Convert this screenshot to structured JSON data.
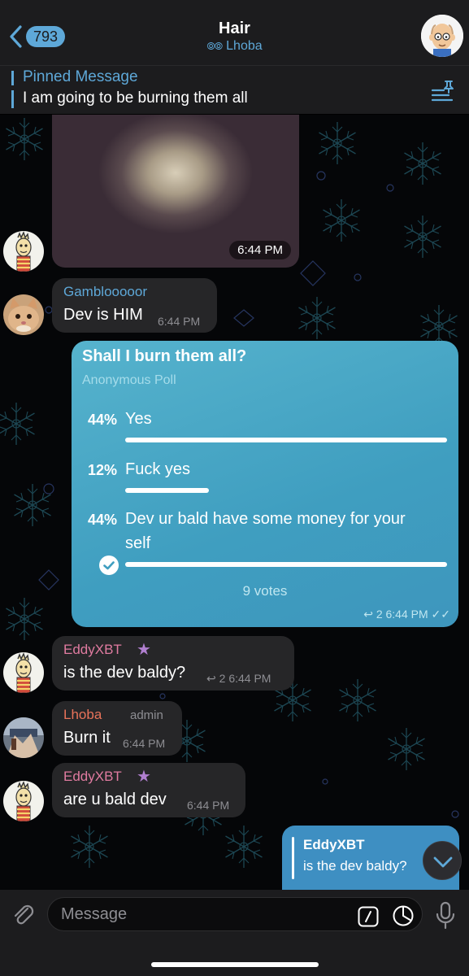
{
  "header": {
    "back_count": "793",
    "title": "Hair",
    "subtitle": "Lhoba",
    "subtitle_icon": "eyes-icon"
  },
  "pinned": {
    "title": "Pinned Message",
    "text": "I am going to be burning them all"
  },
  "messages": {
    "photo_time": "6:44 PM",
    "m1": {
      "sender": "Gamblooooor",
      "text": "Dev is HIM",
      "time": "6:44 PM"
    },
    "m2": {
      "sender": "EddyXBT",
      "text": "is the dev baldy?",
      "replies": "2",
      "time": "6:44 PM"
    },
    "m3": {
      "sender": "Lhoba",
      "role": "admin",
      "text": "Burn it",
      "time": "6:44 PM"
    },
    "m4": {
      "sender": "EddyXBT",
      "text": "are u bald dev",
      "time": "6:44 PM"
    }
  },
  "poll": {
    "question": "Shall I burn them all?",
    "type": "Anonymous Poll",
    "options": [
      {
        "percent": "44%",
        "label": "Yes",
        "share": 44,
        "fill": 1.0
      },
      {
        "percent": "12%",
        "label": "Fuck yes",
        "share": 12,
        "fill": 0.26
      },
      {
        "percent": "44%",
        "label_line1": "Dev ur bald have some money for your",
        "label_line2": "self",
        "share": 44,
        "fill": 1.0,
        "chosen": true
      }
    ],
    "votes": "9 votes",
    "replies": "2",
    "time": "6:44 PM"
  },
  "outgoing_reply": {
    "quoted_name": "EddyXBT",
    "quoted_text": "is the dev baldy?"
  },
  "input": {
    "placeholder": "Message"
  },
  "colors": {
    "accent": "#5ea8d8",
    "poll_bubble": "#4aa8c8",
    "outgoing_bubble": "#3e8fc2",
    "incoming_bubble": "#262628",
    "name_pink": "#e07ba0",
    "name_orange": "#e8735a",
    "name_teal": "#5ea8d8",
    "star": "#b07fcf"
  }
}
